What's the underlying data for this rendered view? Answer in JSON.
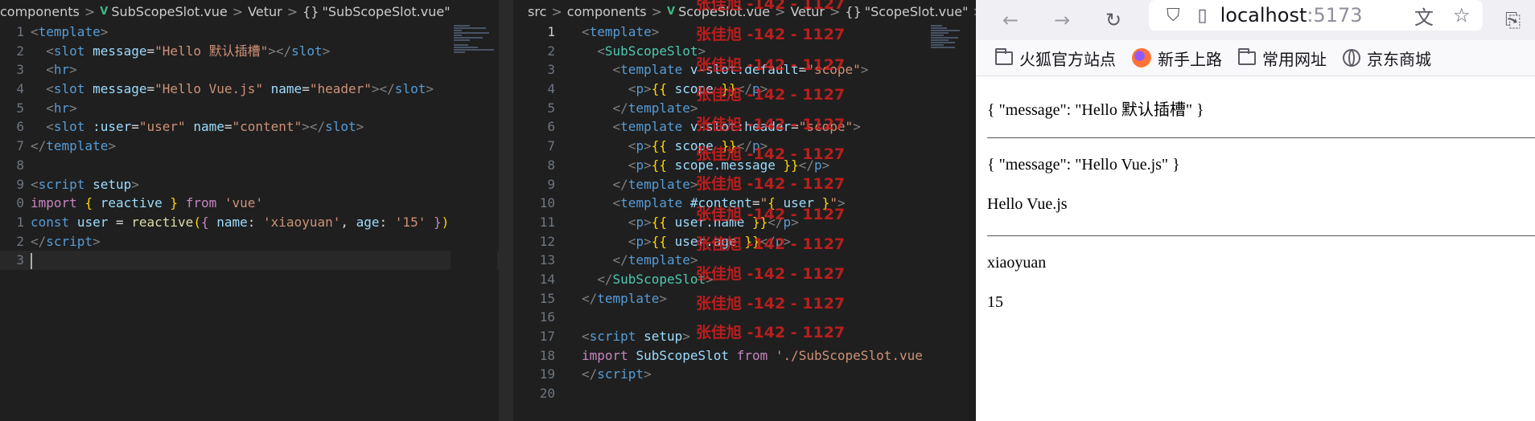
{
  "left_editor": {
    "breadcrumb": [
      "components",
      "SubScopeSlot.vue",
      "Vetur",
      "\"SubScopeSlot.vue\""
    ],
    "lines": [
      {
        "n": "1",
        "tokens": [
          [
            "t-br",
            "<"
          ],
          [
            "t-tag",
            "template"
          ],
          [
            "t-br",
            ">"
          ]
        ]
      },
      {
        "n": "2",
        "tokens": [
          [
            "t-plain",
            "  "
          ],
          [
            "t-br",
            "<"
          ],
          [
            "t-tag",
            "slot"
          ],
          [
            "t-plain",
            " "
          ],
          [
            "t-attr",
            "message"
          ],
          [
            "t-plain",
            "="
          ],
          [
            "t-str",
            "\"Hello 默认插槽\""
          ],
          [
            "t-br",
            "></"
          ],
          [
            "t-tag",
            "slot"
          ],
          [
            "t-br",
            ">"
          ]
        ]
      },
      {
        "n": "3",
        "tokens": [
          [
            "t-plain",
            "  "
          ],
          [
            "t-br",
            "<"
          ],
          [
            "t-tag",
            "hr"
          ],
          [
            "t-br",
            ">"
          ]
        ]
      },
      {
        "n": "4",
        "tokens": [
          [
            "t-plain",
            "  "
          ],
          [
            "t-br",
            "<"
          ],
          [
            "t-tag",
            "slot"
          ],
          [
            "t-plain",
            " "
          ],
          [
            "t-attr",
            "message"
          ],
          [
            "t-plain",
            "="
          ],
          [
            "t-str",
            "\"Hello Vue.js\""
          ],
          [
            "t-plain",
            " "
          ],
          [
            "t-attr",
            "name"
          ],
          [
            "t-plain",
            "="
          ],
          [
            "t-str",
            "\"header\""
          ],
          [
            "t-br",
            "></"
          ],
          [
            "t-tag",
            "slot"
          ],
          [
            "t-br",
            ">"
          ]
        ]
      },
      {
        "n": "5",
        "tokens": [
          [
            "t-plain",
            "  "
          ],
          [
            "t-br",
            "<"
          ],
          [
            "t-tag",
            "hr"
          ],
          [
            "t-br",
            ">"
          ]
        ]
      },
      {
        "n": "6",
        "tokens": [
          [
            "t-plain",
            "  "
          ],
          [
            "t-br",
            "<"
          ],
          [
            "t-tag",
            "slot"
          ],
          [
            "t-plain",
            " "
          ],
          [
            "t-attr",
            ":user"
          ],
          [
            "t-plain",
            "="
          ],
          [
            "t-str",
            "\"user\""
          ],
          [
            "t-plain",
            " "
          ],
          [
            "t-attr",
            "name"
          ],
          [
            "t-plain",
            "="
          ],
          [
            "t-str",
            "\"content\""
          ],
          [
            "t-br",
            "></"
          ],
          [
            "t-tag",
            "slot"
          ],
          [
            "t-br",
            ">"
          ]
        ]
      },
      {
        "n": "7",
        "tokens": [
          [
            "t-br",
            "</"
          ],
          [
            "t-tag",
            "template"
          ],
          [
            "t-br",
            ">"
          ]
        ]
      },
      {
        "n": "8",
        "tokens": []
      },
      {
        "n": "9",
        "tokens": [
          [
            "t-br",
            "<"
          ],
          [
            "t-tag",
            "script"
          ],
          [
            "t-plain",
            " "
          ],
          [
            "t-attr",
            "setup"
          ],
          [
            "t-br",
            ">"
          ]
        ]
      },
      {
        "n": "0",
        "tokens": [
          [
            "t-kw",
            "import"
          ],
          [
            "t-plain",
            " "
          ],
          [
            "t-curly",
            "{"
          ],
          [
            "t-plain",
            " "
          ],
          [
            "t-var",
            "reactive"
          ],
          [
            "t-plain",
            " "
          ],
          [
            "t-curly",
            "}"
          ],
          [
            "t-plain",
            " "
          ],
          [
            "t-kw",
            "from"
          ],
          [
            "t-plain",
            " "
          ],
          [
            "t-str",
            "'vue'"
          ]
        ]
      },
      {
        "n": "1",
        "tokens": [
          [
            "t-tag",
            "const"
          ],
          [
            "t-plain",
            " "
          ],
          [
            "t-var",
            "user"
          ],
          [
            "t-plain",
            " = "
          ],
          [
            "t-fn",
            "reactive"
          ],
          [
            "t-curly",
            "("
          ],
          [
            "t-kw",
            "{"
          ],
          [
            "t-plain",
            " "
          ],
          [
            "t-var",
            "name"
          ],
          [
            "t-plain",
            ": "
          ],
          [
            "t-str",
            "'xiaoyuan'"
          ],
          [
            "t-plain",
            ", "
          ],
          [
            "t-var",
            "age"
          ],
          [
            "t-plain",
            ": "
          ],
          [
            "t-str",
            "'15'"
          ],
          [
            "t-plain",
            " "
          ],
          [
            "t-kw",
            "}"
          ],
          [
            "t-curly",
            ")"
          ]
        ]
      },
      {
        "n": "2",
        "tokens": [
          [
            "t-br",
            "</"
          ],
          [
            "t-tag",
            "script"
          ],
          [
            "t-br",
            ">"
          ]
        ]
      },
      {
        "n": "3",
        "tokens": [],
        "cursor": true
      }
    ]
  },
  "mid_editor": {
    "breadcrumb": [
      "src",
      "components",
      "ScopeSlot.vue",
      "Vetur",
      "\"ScopeSlot.vue\"",
      "te"
    ],
    "lines": [
      {
        "n": "1",
        "tokens": [
          [
            "t-br",
            "<"
          ],
          [
            "t-tag",
            "template"
          ],
          [
            "t-br",
            ">"
          ]
        ]
      },
      {
        "n": "2",
        "tokens": [
          [
            "t-plain",
            "  "
          ],
          [
            "t-br",
            "<"
          ],
          [
            "t-comp",
            "SubScopeSlot"
          ],
          [
            "t-br",
            ">"
          ]
        ]
      },
      {
        "n": "3",
        "tokens": [
          [
            "t-plain",
            "    "
          ],
          [
            "t-br",
            "<"
          ],
          [
            "t-tag",
            "template"
          ],
          [
            "t-plain",
            " "
          ],
          [
            "t-attr",
            "v-slot:default"
          ],
          [
            "t-plain",
            "="
          ],
          [
            "t-str",
            "\"scope\""
          ],
          [
            "t-br",
            ">"
          ]
        ]
      },
      {
        "n": "4",
        "tokens": [
          [
            "t-plain",
            "      "
          ],
          [
            "t-br",
            "<"
          ],
          [
            "t-tag",
            "p"
          ],
          [
            "t-br",
            ">"
          ],
          [
            "t-curly",
            "{{"
          ],
          [
            "t-plain",
            " "
          ],
          [
            "t-var",
            "scope"
          ],
          [
            "t-plain",
            " "
          ],
          [
            "t-curly",
            "}}"
          ],
          [
            "t-br",
            "</"
          ],
          [
            "t-tag",
            "p"
          ],
          [
            "t-br",
            ">"
          ]
        ]
      },
      {
        "n": "5",
        "tokens": [
          [
            "t-plain",
            "    "
          ],
          [
            "t-br",
            "</"
          ],
          [
            "t-tag",
            "template"
          ],
          [
            "t-br",
            ">"
          ]
        ]
      },
      {
        "n": "6",
        "tokens": [
          [
            "t-plain",
            "    "
          ],
          [
            "t-br",
            "<"
          ],
          [
            "t-tag",
            "template"
          ],
          [
            "t-plain",
            " "
          ],
          [
            "t-attr",
            "v-slot:header"
          ],
          [
            "t-plain",
            "="
          ],
          [
            "t-str",
            "\"scope\""
          ],
          [
            "t-br",
            ">"
          ]
        ]
      },
      {
        "n": "7",
        "tokens": [
          [
            "t-plain",
            "      "
          ],
          [
            "t-br",
            "<"
          ],
          [
            "t-tag",
            "p"
          ],
          [
            "t-br",
            ">"
          ],
          [
            "t-curly",
            "{{"
          ],
          [
            "t-plain",
            " "
          ],
          [
            "t-var",
            "scope"
          ],
          [
            "t-plain",
            " "
          ],
          [
            "t-curly",
            "}}"
          ],
          [
            "t-br",
            "</"
          ],
          [
            "t-tag",
            "p"
          ],
          [
            "t-br",
            ">"
          ]
        ]
      },
      {
        "n": "8",
        "tokens": [
          [
            "t-plain",
            "      "
          ],
          [
            "t-br",
            "<"
          ],
          [
            "t-tag",
            "p"
          ],
          [
            "t-br",
            ">"
          ],
          [
            "t-curly",
            "{{"
          ],
          [
            "t-plain",
            " "
          ],
          [
            "t-var",
            "scope.message"
          ],
          [
            "t-plain",
            " "
          ],
          [
            "t-curly",
            "}}"
          ],
          [
            "t-br",
            "</"
          ],
          [
            "t-tag",
            "p"
          ],
          [
            "t-br",
            ">"
          ]
        ]
      },
      {
        "n": "9",
        "tokens": [
          [
            "t-plain",
            "    "
          ],
          [
            "t-br",
            "</"
          ],
          [
            "t-tag",
            "template"
          ],
          [
            "t-br",
            ">"
          ]
        ]
      },
      {
        "n": "10",
        "tokens": [
          [
            "t-plain",
            "    "
          ],
          [
            "t-br",
            "<"
          ],
          [
            "t-tag",
            "template"
          ],
          [
            "t-plain",
            " "
          ],
          [
            "t-attr",
            "#content"
          ],
          [
            "t-plain",
            "="
          ],
          [
            "t-str",
            "\""
          ],
          [
            "t-curly",
            "{"
          ],
          [
            "t-plain",
            " "
          ],
          [
            "t-var",
            "user"
          ],
          [
            "t-plain",
            " "
          ],
          [
            "t-curly",
            "}"
          ],
          [
            "t-str",
            "\""
          ],
          [
            "t-br",
            ">"
          ]
        ]
      },
      {
        "n": "11",
        "tokens": [
          [
            "t-plain",
            "      "
          ],
          [
            "t-br",
            "<"
          ],
          [
            "t-tag",
            "p"
          ],
          [
            "t-br",
            ">"
          ],
          [
            "t-curly",
            "{{"
          ],
          [
            "t-plain",
            " "
          ],
          [
            "t-var",
            "user.name"
          ],
          [
            "t-plain",
            " "
          ],
          [
            "t-curly",
            "}}"
          ],
          [
            "t-br",
            "</"
          ],
          [
            "t-tag",
            "p"
          ],
          [
            "t-br",
            ">"
          ]
        ]
      },
      {
        "n": "12",
        "tokens": [
          [
            "t-plain",
            "      "
          ],
          [
            "t-br",
            "<"
          ],
          [
            "t-tag",
            "p"
          ],
          [
            "t-br",
            ">"
          ],
          [
            "t-curly",
            "{{"
          ],
          [
            "t-plain",
            " "
          ],
          [
            "t-var",
            "user.age"
          ],
          [
            "t-plain",
            " "
          ],
          [
            "t-curly",
            "}}"
          ],
          [
            "t-br",
            "</"
          ],
          [
            "t-tag",
            "p"
          ],
          [
            "t-br",
            ">"
          ]
        ]
      },
      {
        "n": "13",
        "tokens": [
          [
            "t-plain",
            "    "
          ],
          [
            "t-br",
            "</"
          ],
          [
            "t-tag",
            "template"
          ],
          [
            "t-br",
            ">"
          ]
        ]
      },
      {
        "n": "14",
        "tokens": [
          [
            "t-plain",
            "  "
          ],
          [
            "t-br",
            "</"
          ],
          [
            "t-comp",
            "SubScopeSlot"
          ],
          [
            "t-br",
            ">"
          ]
        ]
      },
      {
        "n": "15",
        "tokens": [
          [
            "t-br",
            "</"
          ],
          [
            "t-tag",
            "template"
          ],
          [
            "t-br",
            ">"
          ]
        ]
      },
      {
        "n": "16",
        "tokens": []
      },
      {
        "n": "17",
        "tokens": [
          [
            "t-br",
            "<"
          ],
          [
            "t-tag",
            "script"
          ],
          [
            "t-plain",
            " "
          ],
          [
            "t-attr",
            "setup"
          ],
          [
            "t-br",
            ">"
          ]
        ]
      },
      {
        "n": "18",
        "tokens": [
          [
            "t-kw",
            "import"
          ],
          [
            "t-plain",
            " "
          ],
          [
            "t-var",
            "SubScopeSlot"
          ],
          [
            "t-plain",
            " "
          ],
          [
            "t-kw",
            "from"
          ],
          [
            "t-plain",
            " "
          ],
          [
            "t-str",
            "'./SubScopeSlot.vue"
          ]
        ]
      },
      {
        "n": "19",
        "tokens": [
          [
            "t-br",
            "</"
          ],
          [
            "t-tag",
            "script"
          ],
          [
            "t-br",
            ">"
          ]
        ]
      },
      {
        "n": "20",
        "tokens": []
      }
    ]
  },
  "watermark": {
    "text": "张佳旭 -142 - 1127"
  },
  "browser": {
    "url_host": "localhost",
    "url_port": ":5173",
    "bookmarks": [
      {
        "label": "火狐官方站点",
        "icon": "folder-icon"
      },
      {
        "label": "新手上路",
        "icon": "firefox-icon"
      },
      {
        "label": "常用网址",
        "icon": "folder-icon"
      },
      {
        "label": "京东商城",
        "icon": "globe-icon"
      }
    ],
    "content": {
      "p1": "{ \"message\": \"Hello 默认插槽\" }",
      "p2": "{ \"message\": \"Hello Vue.js\" }",
      "p3": "Hello Vue.js",
      "p4": "xiaoyuan",
      "p5": "15"
    }
  }
}
